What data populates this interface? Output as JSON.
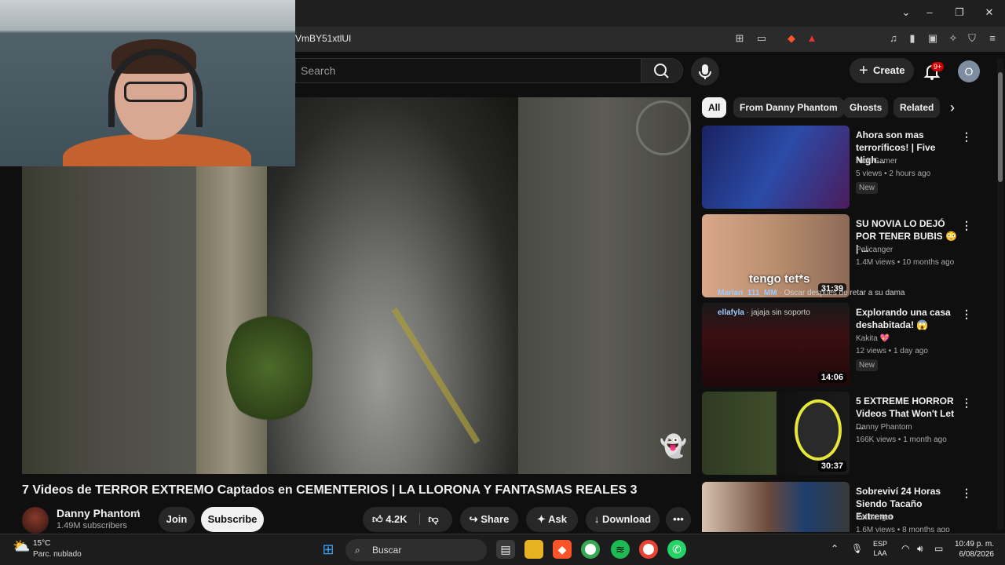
{
  "browser": {
    "url": "VmBY51xtlUI",
    "window_controls": [
      "⌄",
      "–",
      "❐",
      "✕"
    ]
  },
  "youtube": {
    "search_placeholder": "Search",
    "create_label": "Create",
    "notification_count": "9+",
    "account_initial": "O"
  },
  "video": {
    "title": "7 Videos de TERROR EXTREMO Captados en CEMENTERIOS | LA LLORONA Y FANTASMAS REALES 3",
    "channel": "Danny Phantom",
    "subscribers": "1.49M subscribers",
    "join_label": "Join",
    "subscribe_label": "Subscribe",
    "likes": "4.2K",
    "share_label": "Share",
    "ask_label": "Ask",
    "download_label": "Download"
  },
  "chips": [
    {
      "label": "All",
      "active": true
    },
    {
      "label": "From Danny Phantom",
      "active": false
    },
    {
      "label": "Ghosts",
      "active": false
    },
    {
      "label": "Related",
      "active": false
    }
  ],
  "recommendations": [
    {
      "title": "Ahora son mas terroríficos! | Five Nigh...",
      "channel": "Nick Gamer",
      "meta": "5 views • 2 hours ago",
      "badge": "New",
      "duration": "",
      "thumb_color": "#2b3a8a"
    },
    {
      "title": "SU NOVIA LO DEJÓ POR TENER BUBIS 😳 | ...",
      "channel": "Pelicanger",
      "meta": "1.4M views • 10 months ago",
      "badge": "",
      "duration": "31:39",
      "thumb_color": "#b98e6e"
    },
    {
      "title": "Explorando una casa deshabitada! 😱",
      "channel": "Kakita 💖",
      "meta": "12 views • 1 day ago",
      "badge": "New",
      "duration": "14:06",
      "thumb_color": "#3a0f12"
    },
    {
      "title": "5 EXTREME HORROR Videos That Won't Let ...",
      "channel": "Danny Phantom",
      "meta": "166K views • 1 month ago",
      "badge": "",
      "duration": "30:37",
      "thumb_color": "#2e3a22"
    },
    {
      "title": "Sobreviví 24 Horas Siendo Tacaño Extremo",
      "channel": "Pelicanger",
      "meta": "1.6M views • 8 months ago",
      "badge": "",
      "duration": "",
      "thumb_color": "#6b4a3a"
    }
  ],
  "chat": [
    {
      "user": "Marian_111_MM",
      "text": "Oscar despues de retar a su dama"
    },
    {
      "user": "ellafyla",
      "text": "jajaja sin soporto"
    }
  ],
  "thumb_overlay_text": "tengo tet*s",
  "taskbar": {
    "temperature": "15°C",
    "weather": "Parc. nublado",
    "search_label": "Buscar",
    "lang_line1": "ESP",
    "lang_line2": "LAA",
    "time": "10:49 p. m.",
    "date": "6/08/2026"
  }
}
